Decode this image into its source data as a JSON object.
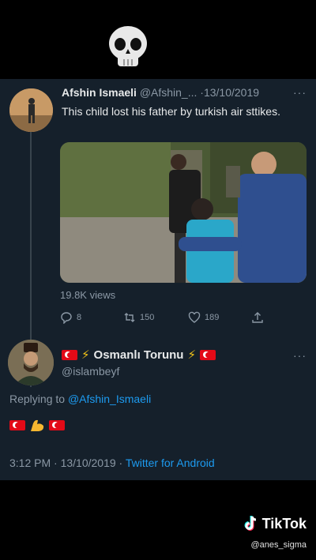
{
  "overlay": {
    "top_emoji": "skull-emoji"
  },
  "tweet1": {
    "display_name": "Afshin Ismaeli",
    "handle_date": "@Afshin_... ·13/10/2019",
    "more": "···",
    "text": "This child lost his father by turkish air sttikes.",
    "views": "19.8K views",
    "replies": "8",
    "retweets": "150",
    "likes": "189"
  },
  "tweet2": {
    "display_name": "Osmanlı Torunu",
    "handle": "@islambeyf",
    "more": "···",
    "replying_prefix": "Replying to ",
    "replying_to": "@Afshin_Ismaeli",
    "timestamp": "3:12 PM · 13/10/2019 · ",
    "source": "Twitter for Android"
  },
  "watermark": {
    "brand": "TikTok",
    "handle": "@anes_sigma"
  },
  "colors": {
    "panel": "#15202b",
    "accent": "#1d9bf0",
    "muted": "#8b98a5",
    "flag": "#e30a17"
  }
}
